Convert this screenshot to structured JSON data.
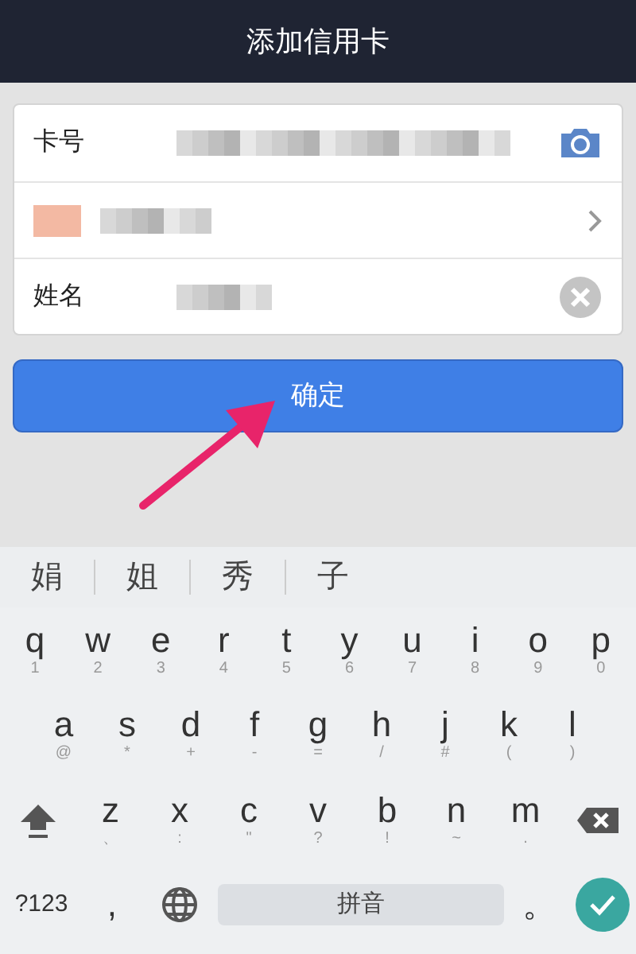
{
  "header": {
    "title": "添加信用卡"
  },
  "form": {
    "rows": [
      {
        "kind": "input",
        "label": "卡号",
        "trailing": {
          "kind": "camera"
        }
      },
      {
        "kind": "select",
        "trailing": {
          "kind": "chevron"
        }
      },
      {
        "kind": "input",
        "label": "姓名",
        "trailing": {
          "kind": "clear"
        }
      }
    ]
  },
  "confirm_button": {
    "label": "确定"
  },
  "candidates": [
    "娟",
    "姐",
    "秀",
    "子"
  ],
  "keyboard": {
    "rows": [
      {
        "keys": [
          {
            "kind": "char",
            "main": "q",
            "alt": "1"
          },
          {
            "kind": "char",
            "main": "w",
            "alt": "2"
          },
          {
            "kind": "char",
            "main": "e",
            "alt": "3"
          },
          {
            "kind": "char",
            "main": "r",
            "alt": "4"
          },
          {
            "kind": "char",
            "main": "t",
            "alt": "5"
          },
          {
            "kind": "char",
            "main": "y",
            "alt": "6"
          },
          {
            "kind": "char",
            "main": "u",
            "alt": "7"
          },
          {
            "kind": "char",
            "main": "i",
            "alt": "8"
          },
          {
            "kind": "char",
            "main": "o",
            "alt": "9"
          },
          {
            "kind": "char",
            "main": "p",
            "alt": "0"
          }
        ]
      },
      {
        "keys": [
          {
            "kind": "char",
            "main": "a",
            "alt": "@"
          },
          {
            "kind": "char",
            "main": "s",
            "alt": "*"
          },
          {
            "kind": "char",
            "main": "d",
            "alt": "+"
          },
          {
            "kind": "char",
            "main": "f",
            "alt": "-"
          },
          {
            "kind": "char",
            "main": "g",
            "alt": "="
          },
          {
            "kind": "char",
            "main": "h",
            "alt": "/"
          },
          {
            "kind": "char",
            "main": "j",
            "alt": "#"
          },
          {
            "kind": "char",
            "main": "k",
            "alt": "("
          },
          {
            "kind": "char",
            "main": "l",
            "alt": ")"
          }
        ]
      },
      {
        "keys": [
          {
            "kind": "shift"
          },
          {
            "kind": "char",
            "main": "z",
            "alt": "、"
          },
          {
            "kind": "char",
            "main": "x",
            "alt": ":"
          },
          {
            "kind": "char",
            "main": "c",
            "alt": "\""
          },
          {
            "kind": "char",
            "main": "v",
            "alt": "?"
          },
          {
            "kind": "char",
            "main": "b",
            "alt": "!"
          },
          {
            "kind": "char",
            "main": "n",
            "alt": "~"
          },
          {
            "kind": "char",
            "main": "m",
            "alt": "."
          },
          {
            "kind": "backspace"
          }
        ]
      },
      {
        "keys": [
          {
            "kind": "text",
            "main": "?123"
          },
          {
            "kind": "char",
            "main": ","
          },
          {
            "kind": "globe"
          },
          {
            "kind": "space",
            "main": "拼音"
          },
          {
            "kind": "char",
            "main": "。"
          },
          {
            "kind": "enter"
          }
        ]
      }
    ]
  }
}
